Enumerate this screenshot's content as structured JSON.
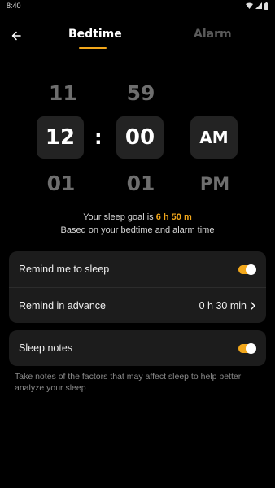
{
  "status": {
    "time": "8:40"
  },
  "tabs": {
    "bedtime": "Bedtime",
    "alarm": "Alarm"
  },
  "picker": {
    "hour": {
      "prev": "11",
      "current": "12",
      "next": "01"
    },
    "colon": ":",
    "minute": {
      "prev": "59",
      "current": "00",
      "next": "01"
    },
    "ampm": {
      "current": "AM",
      "next": "PM"
    }
  },
  "goal": {
    "line1_prefix": "Your sleep goal is ",
    "line1_value": "6 h 50 m",
    "line2": "Based on your bedtime and alarm time"
  },
  "settings": {
    "remind_label": "Remind me to sleep",
    "remind_on": true,
    "advance_label": "Remind in advance",
    "advance_value": "0 h 30 min",
    "notes_label": "Sleep notes",
    "notes_on": true,
    "notes_hint": "Take notes of the factors that may affect sleep to help better analyze your sleep"
  },
  "colors": {
    "accent": "#f2a71b",
    "card": "#1c1c1c",
    "background": "#000000"
  },
  "icons": [
    "back-arrow-icon",
    "chevron-right-icon",
    "wifi-icon",
    "signal-icon",
    "battery-icon"
  ]
}
